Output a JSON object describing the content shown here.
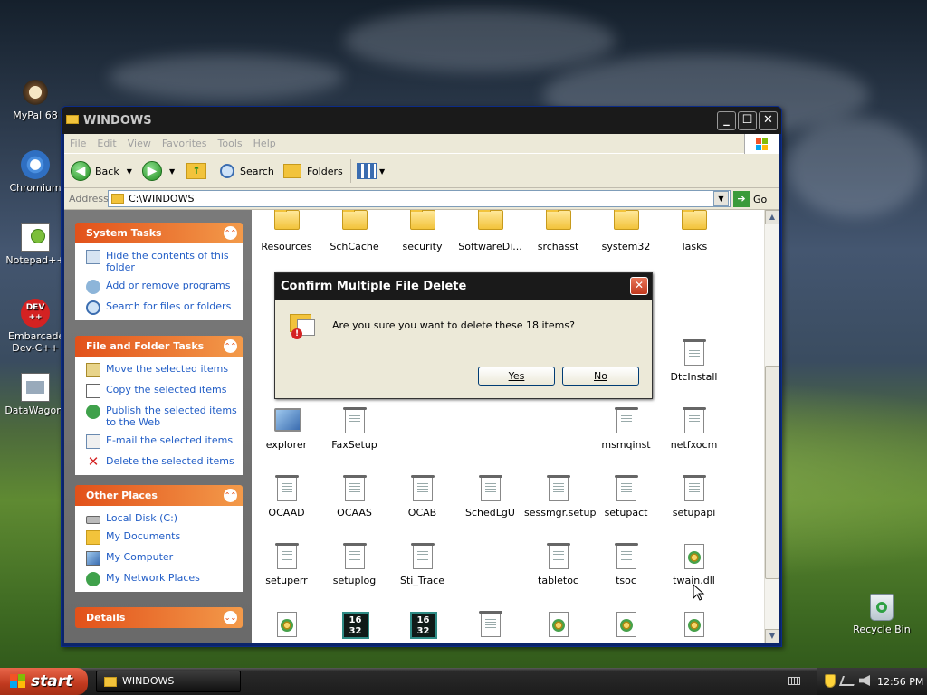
{
  "desktop": {
    "icons": [
      {
        "label": "MyPal 68"
      },
      {
        "label": "Chromium"
      },
      {
        "label": "Notepad++"
      },
      {
        "label": "Embarcadero Dev-C++"
      },
      {
        "label": "DataWagon."
      },
      {
        "label": "Recycle Bin"
      }
    ],
    "dev_badge": "DEV",
    "dev_plus": "++"
  },
  "window": {
    "title": "WINDOWS",
    "menu": [
      "File",
      "Edit",
      "View",
      "Favorites",
      "Tools",
      "Help"
    ],
    "toolbar": {
      "back": "Back",
      "search": "Search",
      "folders": "Folders"
    },
    "address": {
      "label": "Address",
      "value": "C:\\WINDOWS",
      "go": "Go"
    }
  },
  "left_pane": {
    "system_tasks": {
      "title": "System Tasks",
      "items": [
        "Hide the contents of this folder",
        "Add or remove programs",
        "Search for files or folders"
      ]
    },
    "file_folder_tasks": {
      "title": "File and Folder Tasks",
      "items": [
        "Move the selected items",
        "Copy the selected items",
        "Publish the selected items to the Web",
        "E-mail the selected items",
        "Delete the selected items"
      ]
    },
    "other_places": {
      "title": "Other Places",
      "items": [
        "Local Disk (C:)",
        "My Documents",
        "My Computer",
        "My Network Places"
      ]
    },
    "details": {
      "title": "Details"
    }
  },
  "files": {
    "row1": [
      "Resources",
      "SchCache",
      "security",
      "SoftwareDi...",
      "srchasst",
      "system32",
      "Tasks"
    ],
    "dtcinstall": "DtcInstall",
    "row2": [
      "explorer",
      "FaxSetup",
      "msmqinst",
      "netfxocm"
    ],
    "row3": [
      "OCAAD",
      "OCAAS",
      "OCAB",
      "SchedLgU",
      "sessmgr.setup",
      "setupact",
      "setupapi"
    ],
    "row4": [
      "setuperr",
      "setuplog",
      "Sti_Trace",
      "tabletoc",
      "tsoc",
      "twain.dll"
    ],
    "sys_badge": [
      "16",
      "32"
    ]
  },
  "dialog": {
    "title": "Confirm Multiple File Delete",
    "message": "Are you sure you want to delete these 18 items?",
    "yes": "Yes",
    "no": "No"
  },
  "taskbar": {
    "start": "start",
    "task_title": "WINDOWS",
    "clock": "12:56 PM"
  }
}
